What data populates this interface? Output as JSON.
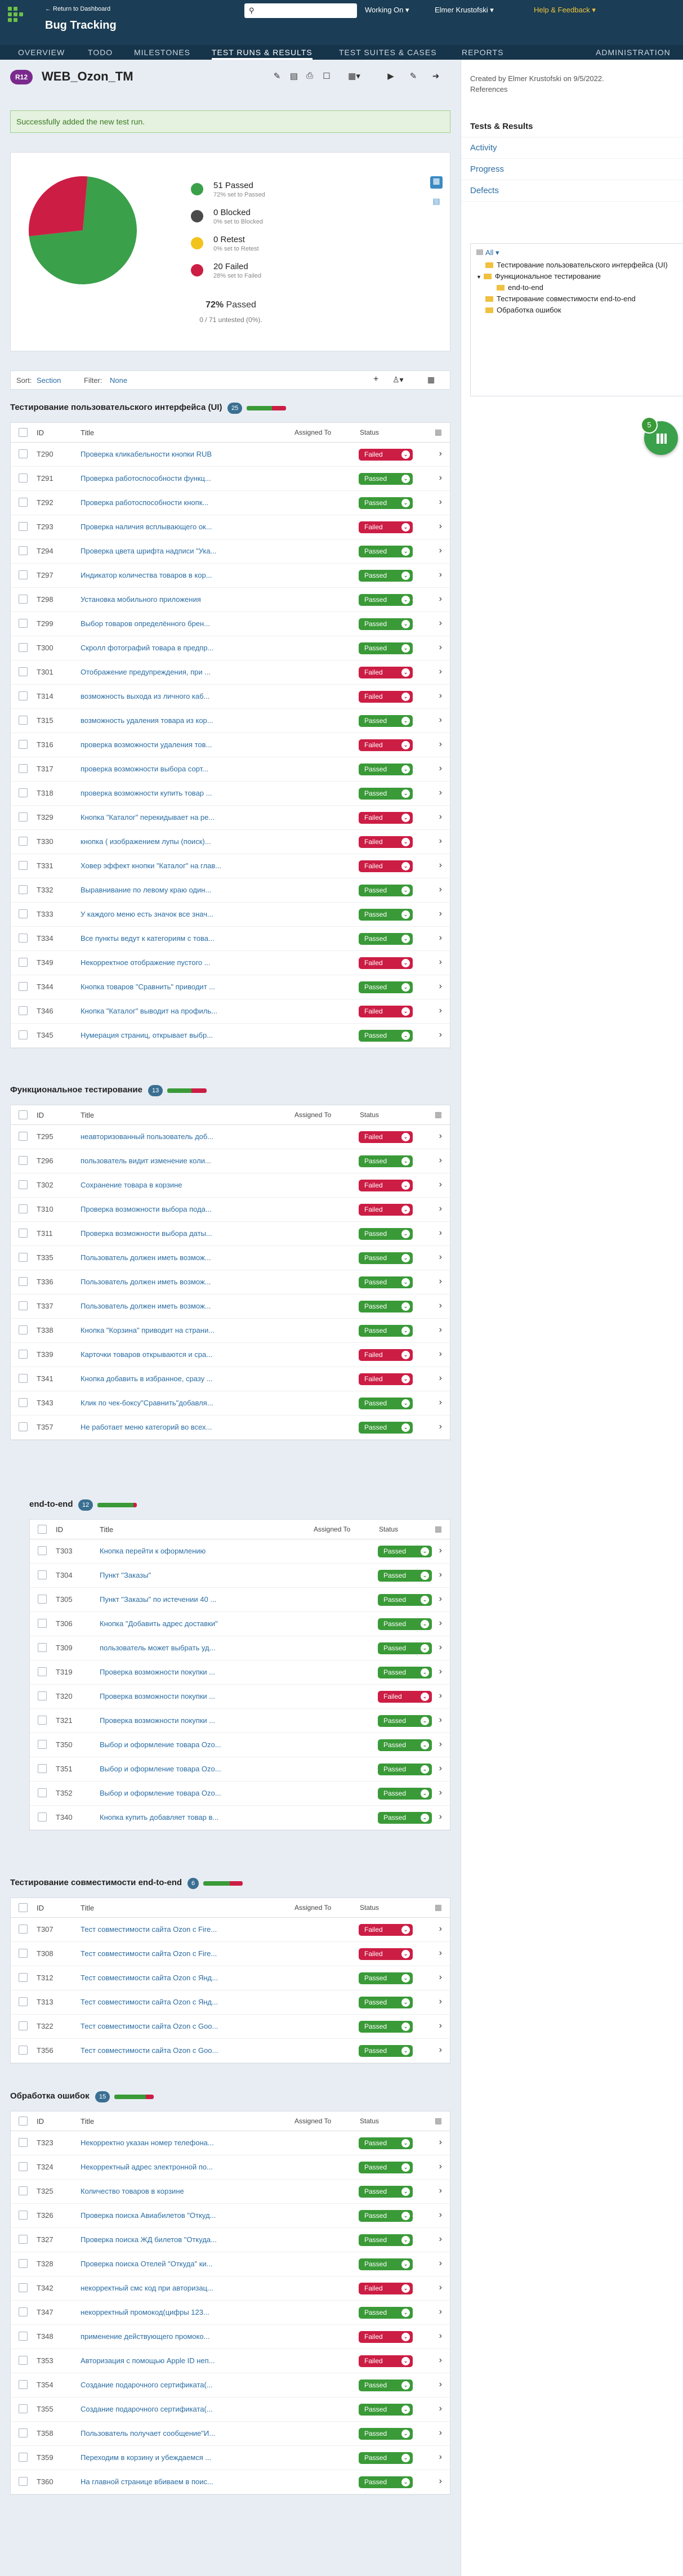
{
  "header": {
    "back_link": "← Return to Dashboard",
    "app_title": "Bug Tracking",
    "working_on": "Working On ▾",
    "user": "Elmer Krustofski ▾",
    "help": "Help & Feedback ▾"
  },
  "nav": {
    "tabs": [
      "OVERVIEW",
      "TODO",
      "MILESTONES",
      "TEST RUNS & RESULTS",
      "TEST SUITES & CASES",
      "REPORTS"
    ],
    "admin": "ADMINISTRATION"
  },
  "run": {
    "badge": "R12",
    "title": "WEB_Ozon_TM"
  },
  "success_message": "Successfully added the new test run.",
  "stats": {
    "chart_data": {
      "type": "pie",
      "categories": [
        "Passed",
        "Blocked",
        "Retest",
        "Failed"
      ],
      "values": [
        51,
        0,
        0,
        20
      ],
      "colors": [
        "#3aa04a",
        "#444444",
        "#f2c31c",
        "#cc1d44"
      ]
    },
    "legend": [
      {
        "title": "51 Passed",
        "sub": "72% set to Passed",
        "color": "#3aa04a"
      },
      {
        "title": "0 Blocked",
        "sub": "0% set to Blocked",
        "color": "#4a4a4a"
      },
      {
        "title": "0 Retest",
        "sub": "0% set to Retest",
        "color": "#f2c31c"
      },
      {
        "title": "20 Failed",
        "sub": "28% set to Failed",
        "color": "#cc1d44"
      }
    ],
    "percent": "72%",
    "percent_label": "Passed",
    "untested": "0 / 71 untested (0%)."
  },
  "sortbar": {
    "sort_label": "Sort:",
    "sort_value": "Section",
    "filter_label": "Filter:",
    "filter_value": "None"
  },
  "table_headers": {
    "id": "ID",
    "title": "Title",
    "assigned": "Assigned To",
    "status": "Status"
  },
  "sections": [
    {
      "title": "Тестирование пользовательского интерфейса (UI)",
      "count": "25",
      "passed": 16,
      "failed": 9,
      "rows": [
        [
          "T290",
          "Проверка кликабельности кнопки RUB",
          "Failed"
        ],
        [
          "T291",
          "Проверка работоспособности функц...",
          "Passed"
        ],
        [
          "T292",
          "Проверка работоспособности кнопк...",
          "Passed"
        ],
        [
          "T293",
          "Проверка наличия всплывающего ок...",
          "Failed"
        ],
        [
          "T294",
          "Проверка цвета шрифта надписи \"Ука...",
          "Passed"
        ],
        [
          "T297",
          "Индикатор количества товаров в кор...",
          "Passed"
        ],
        [
          "T298",
          "Установка мобильного приложения",
          "Passed"
        ],
        [
          "T299",
          "Выбор товаров определённого брен...",
          "Passed"
        ],
        [
          "T300",
          "Скролл фотографий товара в предпр...",
          "Passed"
        ],
        [
          "T301",
          "Отображение предупреждения, при ...",
          "Failed"
        ],
        [
          "T314",
          "возможность выхода из личного каб...",
          "Failed"
        ],
        [
          "T315",
          "возможность удаления товара из кор...",
          "Passed"
        ],
        [
          "T316",
          "проверка возможности удаления тов...",
          "Failed"
        ],
        [
          "T317",
          "проверка возможности выбора сорт...",
          "Passed"
        ],
        [
          "T318",
          "проверка возможности купить товар ...",
          "Passed"
        ],
        [
          "T329",
          "Кнопка \"Каталог\" перекидывает на ре...",
          "Failed"
        ],
        [
          "T330",
          "кнопка ( изображением лупы (поиск)...",
          "Failed"
        ],
        [
          "T331",
          "Ховер эффект кнопки \"Каталог\" на глав...",
          "Failed"
        ],
        [
          "T332",
          "Выравнивание по левому краю один...",
          "Passed"
        ],
        [
          "T333",
          "У каждого меню есть значок все знач...",
          "Passed"
        ],
        [
          "T334",
          "Все пункты ведут к категориям с това...",
          "Passed"
        ],
        [
          "T349",
          "Некорректное отображение пустого ...",
          "Failed"
        ],
        [
          "T344",
          "Кнопка товаров \"Сравнить\" приводит ...",
          "Passed"
        ],
        [
          "T346",
          "Кнопка \"Каталог\" выводит на профиль...",
          "Failed"
        ],
        [
          "T345",
          "Нумерация страниц, открывает выбр...",
          "Passed"
        ]
      ]
    },
    {
      "title": "Функциональное тестирование",
      "count": "13",
      "passed": 8,
      "failed": 5,
      "rows": [
        [
          "T295",
          "неавторизованный пользователь доб...",
          "Failed"
        ],
        [
          "T296",
          "пользователь видит изменение коли...",
          "Passed"
        ],
        [
          "T302",
          "Сохранение товара в корзине",
          "Failed"
        ],
        [
          "T310",
          "Проверка возможности выбора пода...",
          "Failed"
        ],
        [
          "T311",
          "Проверка возможности выбора даты...",
          "Passed"
        ],
        [
          "T335",
          "Пользователь должен иметь возмож...",
          "Passed"
        ],
        [
          "T336",
          "Пользователь должен иметь возмож...",
          "Passed"
        ],
        [
          "T337",
          "Пользователь должен иметь возмож...",
          "Passed"
        ],
        [
          "T338",
          "Кнопка \"Корзина\" приводит на страни...",
          "Passed"
        ],
        [
          "T339",
          "Карточки товаров открываются и сра...",
          "Failed"
        ],
        [
          "T341",
          "Кнопка добавить в избранное, сразу ...",
          "Failed"
        ],
        [
          "T343",
          "Клик по чек-боксу\"Сравнить\"добавля...",
          "Passed"
        ],
        [
          "T357",
          "Не работает меню категорий во всех...",
          "Passed"
        ]
      ]
    },
    {
      "title": "end-to-end",
      "count": "12",
      "passed": 11,
      "failed": 1,
      "rows": [
        [
          "T303",
          "Кнопка перейти к оформлению",
          "Passed"
        ],
        [
          "T304",
          "Пункт \"Заказы\"",
          "Passed"
        ],
        [
          "T305",
          "Пункт \"Заказы\" по истечении 40 ...",
          "Passed"
        ],
        [
          "T306",
          "Кнопка \"Добавить адрес доставки\"",
          "Passed"
        ],
        [
          "T309",
          "пользователь может выбрать уд...",
          "Passed"
        ],
        [
          "T319",
          "Проверка возможности покупки ...",
          "Passed"
        ],
        [
          "T320",
          "Проверка возможности покупки ...",
          "Failed"
        ],
        [
          "T321",
          "Проверка возможности покупки ...",
          "Passed"
        ],
        [
          "T350",
          "Выбор и оформление товара Ozo...",
          "Passed"
        ],
        [
          "T351",
          "Выбор и оформление товара Ozo...",
          "Passed"
        ],
        [
          "T352",
          "Выбор и оформление товара Ozo...",
          "Passed"
        ],
        [
          "T340",
          "Кнопка купить добавляет товар в...",
          "Passed"
        ]
      ]
    },
    {
      "title": "Тестирование совместимости end-to-end",
      "count": "6",
      "passed": 4,
      "failed": 2,
      "rows": [
        [
          "T307",
          "Тест совместимости сайта Ozon с Fire...",
          "Failed"
        ],
        [
          "T308",
          "Тест совместимости сайта Ozon с Fire...",
          "Failed"
        ],
        [
          "T312",
          "Тест совместимости сайта Ozon с Янд...",
          "Passed"
        ],
        [
          "T313",
          "Тест совместимости сайта Ozon с Янд...",
          "Passed"
        ],
        [
          "T322",
          "Тест совместимости сайта Ozon с Goo...",
          "Passed"
        ],
        [
          "T356",
          "Тест совместимости сайта Ozon с Goo...",
          "Passed"
        ]
      ]
    },
    {
      "title": "Обработка ошибок",
      "count": "15",
      "passed": 12,
      "failed": 3,
      "rows": [
        [
          "T323",
          "Некорректно указан номер телефона...",
          "Passed"
        ],
        [
          "T324",
          "Некорректный адрес электронной по...",
          "Passed"
        ],
        [
          "T325",
          "Количество товаров в корзине",
          "Passed"
        ],
        [
          "T326",
          "Проверка поиска Авиабилетов \"Откуд...",
          "Passed"
        ],
        [
          "T327",
          "Проверка поиска ЖД билетов \"Откуда...",
          "Passed"
        ],
        [
          "T328",
          "Проверка поиска Отелей \"Откуда\" ки...",
          "Passed"
        ],
        [
          "T342",
          "некорректный смс код при авторизац...",
          "Failed"
        ],
        [
          "T347",
          "некорректный промокод(цифры 123...",
          "Passed"
        ],
        [
          "T348",
          "применение действующего промоко...",
          "Failed"
        ],
        [
          "T353",
          "Авторизация с помощью Apple ID неп...",
          "Failed"
        ],
        [
          "T354",
          "Создание подарочного сертификата(...",
          "Passed"
        ],
        [
          "T355",
          "Создание подарочного сертификата(...",
          "Passed"
        ],
        [
          "T358",
          "Пользователь получает сообщение\"И...",
          "Passed"
        ],
        [
          "T359",
          "Переходим в корзину и убеждаемся ...",
          "Passed"
        ],
        [
          "T360",
          "На главной странице вбиваем в поис...",
          "Passed"
        ]
      ]
    }
  ],
  "sidebar": {
    "created_by": "Created by Elmer Krustofski on 9/5/2022.",
    "references": "References",
    "nav": [
      "Tests & Results",
      "Activity",
      "Progress",
      "Defects"
    ],
    "tree_all": "All ▾",
    "tree": [
      "Тестирование пользовательского интерфейса (UI)",
      "Функциональное тестирование",
      "end-to-end",
      "Тестирование совместимости end-to-end",
      "Обработка ошибок"
    ],
    "fab_count": "5"
  },
  "colors": {
    "passed": "#3a9a38",
    "failed": "#cc1d44",
    "header": "#1b3d55",
    "link": "#2b6da3"
  }
}
